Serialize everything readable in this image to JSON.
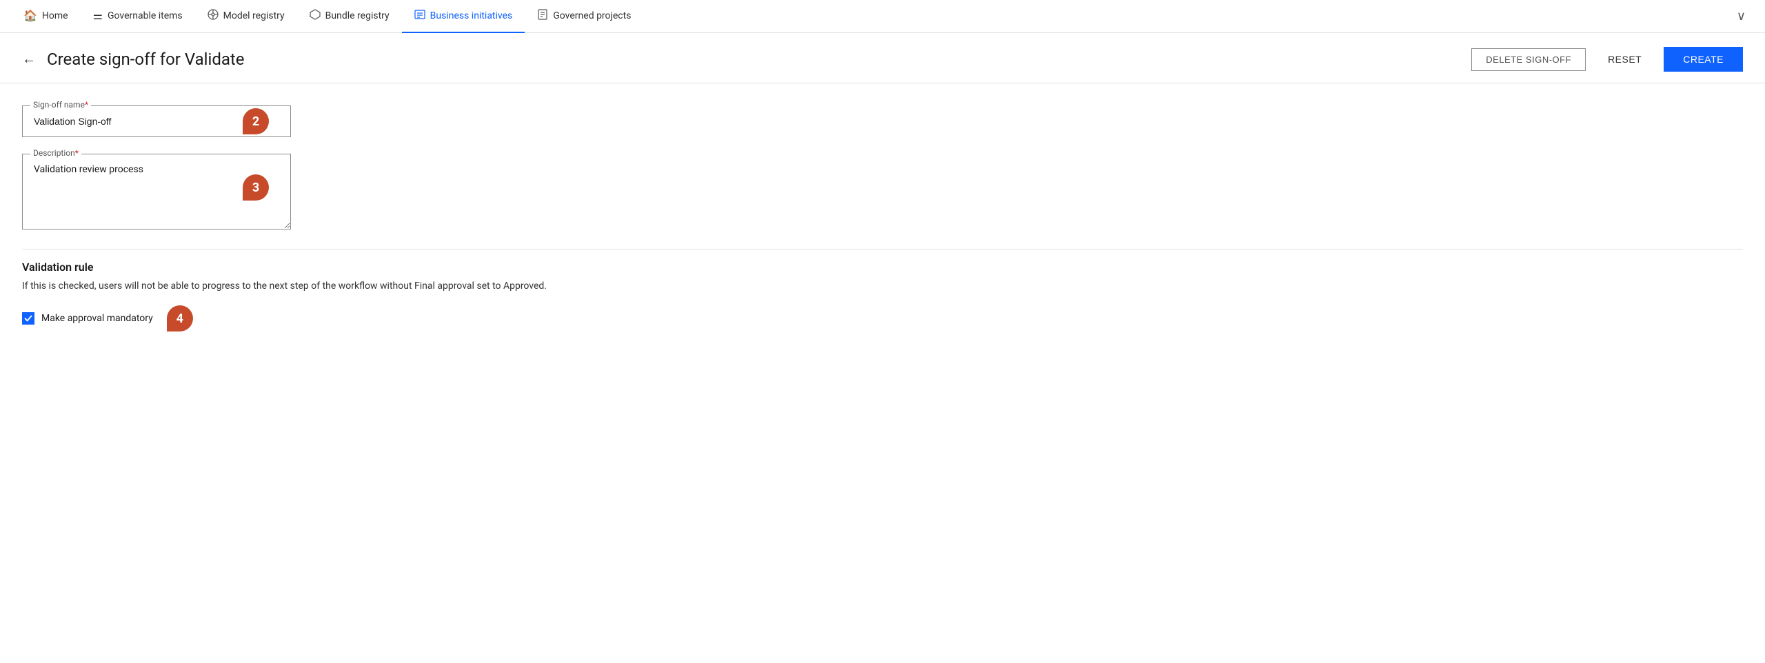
{
  "nav": {
    "items": [
      {
        "id": "home",
        "label": "Home",
        "icon": "🏠"
      },
      {
        "id": "governable-items",
        "label": "Governable items",
        "icon": "≔"
      },
      {
        "id": "model-registry",
        "label": "Model registry",
        "icon": "⊗"
      },
      {
        "id": "bundle-registry",
        "label": "Bundle registry",
        "icon": "⬡"
      },
      {
        "id": "business-initiatives",
        "label": "Business initiatives",
        "icon": "▦",
        "active": true
      },
      {
        "id": "governed-projects",
        "label": "Governed projects",
        "icon": "📋"
      }
    ],
    "chevron": "∨"
  },
  "page": {
    "title": "Create sign-off for Validate",
    "back_label": "←"
  },
  "actions": {
    "delete_label": "DELETE SIGN-OFF",
    "reset_label": "RESET",
    "create_label": "CREATE"
  },
  "form": {
    "signoff_name_label": "Sign-off name",
    "signoff_name_required": "*",
    "signoff_name_value": "Validation Sign-off",
    "signoff_name_badge": "2",
    "description_label": "Description",
    "description_required": "*",
    "description_value": "Validation review process",
    "description_badge": "3"
  },
  "validation_rule": {
    "title": "Validation rule",
    "description": "If this is checked, users will not be able to progress to the next step of the workflow without Final approval set to Approved.",
    "checkbox_label": "Make approval mandatory",
    "checkbox_checked": true,
    "checkbox_badge": "4"
  }
}
